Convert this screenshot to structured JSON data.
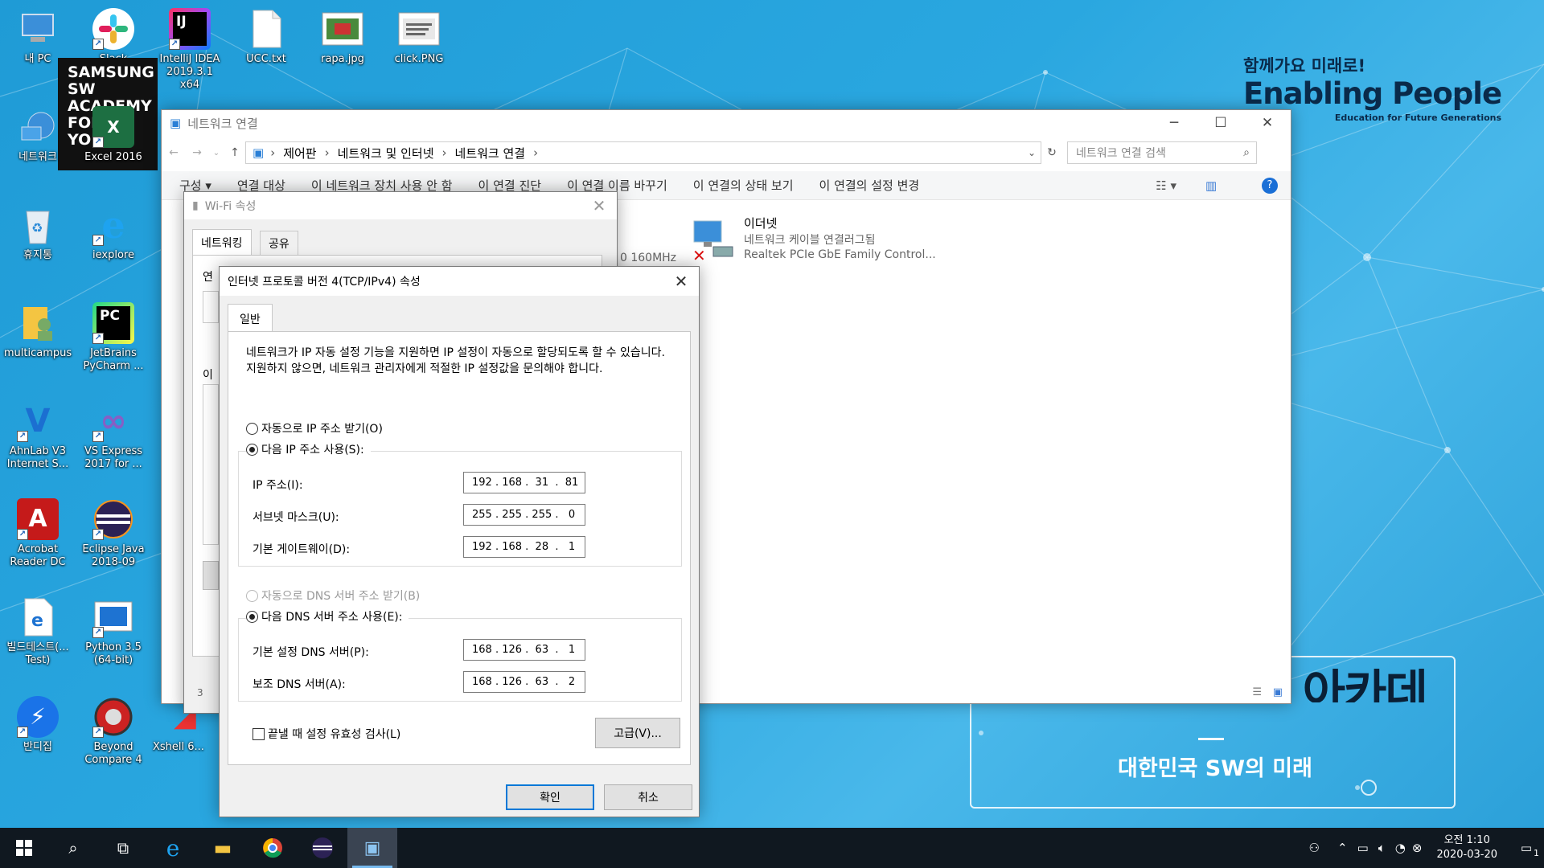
{
  "brand": {
    "slogan": "함께가요 미래로!",
    "main": "Enabling People",
    "sub": "Education for Future Generations"
  },
  "banner": {
    "title": "삼성 청년 SW 아카데미",
    "subtitle": "대한민국 SW의 미래"
  },
  "samsung_tile": [
    "SAMSUNG",
    "SW",
    "ACADEMY",
    "FOR",
    "YOU"
  ],
  "desktop_icons": [
    {
      "name": "my-pc",
      "label": "내 PC"
    },
    {
      "name": "slack",
      "label": "Slack"
    },
    {
      "name": "intellij",
      "label": "IntelliJ IDEA 2019.3.1 x64"
    },
    {
      "name": "ucc",
      "label": "UCC.txt"
    },
    {
      "name": "rapa",
      "label": "rapa.jpg"
    },
    {
      "name": "click",
      "label": "click.PNG"
    },
    {
      "name": "network",
      "label": "네트워크"
    },
    {
      "name": "excel",
      "label": "Excel 2016"
    },
    {
      "name": "recycle",
      "label": "휴지통"
    },
    {
      "name": "iexplore",
      "label": "iexplore"
    },
    {
      "name": "multicampus",
      "label": "multicampus"
    },
    {
      "name": "pycharm",
      "label": "JetBrains PyCharm ..."
    },
    {
      "name": "ahnlab",
      "label": "AhnLab V3 Internet S..."
    },
    {
      "name": "vs",
      "label": "VS Express 2017 for ..."
    },
    {
      "name": "acrobat",
      "label": "Acrobat Reader DC"
    },
    {
      "name": "eclipse",
      "label": "Eclipse Java 2018-09"
    },
    {
      "name": "buildtest",
      "label": "빌드테스트(... Test)"
    },
    {
      "name": "python",
      "label": "Python 3.5 (64-bit)"
    },
    {
      "name": "bandizip",
      "label": "반디집"
    },
    {
      "name": "beyond",
      "label": "Beyond Compare 4"
    },
    {
      "name": "xshell",
      "label": "Xshell 6..."
    }
  ],
  "explorer": {
    "title": "네트워크 연결",
    "breadcrumb": [
      "제어판",
      "네트워크 및 인터넷",
      "네트워크 연결"
    ],
    "search_placeholder": "네트워크 연결 검색",
    "commands": [
      "구성 ▾",
      "연결 대상",
      "이 네트워크 장치 사용 안 함",
      "이 연결 진단",
      "이 연결 이름 바꾸기",
      "이 연결의 상태 보기",
      "이 연결의 설정 변경"
    ],
    "ethernet": {
      "name": "이더넷",
      "status": "네트워크 케이블 연결러그됨",
      "adapter": "Realtek PCIe GbE Family Control..."
    },
    "wifi_partial": "0 160MHz"
  },
  "wifi_dialog": {
    "title": "Wi-Fi 속성",
    "tabs": [
      "네트워킹",
      "공유"
    ],
    "partial_labels": [
      "연",
      "이",
      "3"
    ]
  },
  "ipv4_dialog": {
    "title": "인터넷 프로토콜 버전 4(TCP/IPv4) 속성",
    "tab": "일반",
    "description": "네트워크가 IP 자동 설정 기능을 지원하면 IP 설정이 자동으로 할당되도록 할 수 있습니다. 지원하지 않으면, 네트워크 관리자에게 적절한 IP 설정값을 문의해야 합니다.",
    "auto_ip": "자동으로 IP 주소 받기(O)",
    "manual_ip": "다음 IP 주소 사용(S):",
    "ip_label": "IP 주소(I):",
    "ip_value": "192 . 168 .  31  .  81",
    "mask_label": "서브넷 마스크(U):",
    "mask_value": "255 . 255 . 255 .   0",
    "gw_label": "기본 게이트웨이(D):",
    "gw_value": "192 . 168 .  28  .   1",
    "auto_dns": "자동으로 DNS 서버 주소 받기(B)",
    "manual_dns": "다음 DNS 서버 주소 사용(E):",
    "dns1_label": "기본 설정 DNS 서버(P):",
    "dns1_value": "168 . 126 .  63  .   1",
    "dns2_label": "보조 DNS 서버(A):",
    "dns2_value": "168 . 126 .  63  .   2",
    "validate": "끝낼 때 설정 유효성 검사(L)",
    "advanced": "고급(V)...",
    "ok": "확인",
    "cancel": "취소"
  },
  "taskbar": {
    "clock_time": "오전 1:10",
    "clock_date": "2020-03-20",
    "notif_count": "1"
  }
}
